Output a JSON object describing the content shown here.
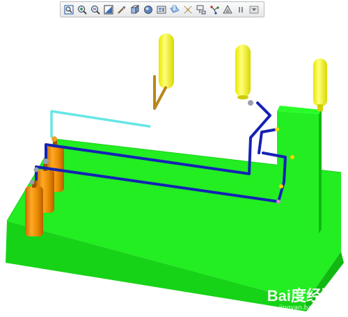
{
  "toolbar": {
    "buttons": [
      {
        "icon": "zoom-to-fit-icon"
      },
      {
        "icon": "zoom-in-icon"
      },
      {
        "icon": "zoom-out-icon"
      },
      {
        "icon": "refit-icon"
      },
      {
        "icon": "repaint-icon"
      },
      {
        "icon": "view-orientation-icon"
      },
      {
        "icon": "display-style-icon"
      },
      {
        "icon": "saved-views-icon"
      },
      {
        "icon": "datum-planes-icon"
      },
      {
        "icon": "datum-axes-icon"
      },
      {
        "icon": "datum-points-icon"
      },
      {
        "icon": "coordinate-system-icon"
      },
      {
        "icon": "annotations-icon"
      },
      {
        "icon": "pause-icon"
      },
      {
        "icon": "spin-center-icon"
      }
    ]
  },
  "colors": {
    "base": "#22ee22",
    "base_dark": "#14c014",
    "tank_orange": "#ee8c00",
    "tank_yellow": "#f6f600",
    "pipe_blue": "#1422b4",
    "pipe_cyan": "#66e6e6",
    "pipe_brown": "#b8861c",
    "fitting": "#9aa0b0"
  },
  "watermark": {
    "logo": "Bai度经验",
    "sub": "jingyan.baidu.com"
  }
}
